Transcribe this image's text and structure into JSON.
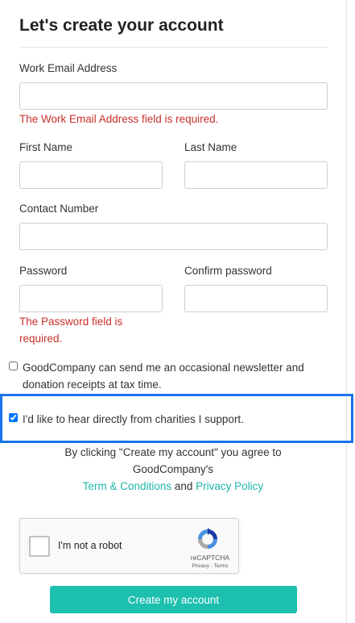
{
  "form": {
    "title": "Let's create your account",
    "email_label": "Work Email Address",
    "email_value": "",
    "email_error": "The Work Email Address field is required.",
    "first_name_label": "First Name",
    "first_name_value": "",
    "last_name_label": "Last Name",
    "last_name_value": "",
    "contact_label": "Contact Number",
    "contact_value": "",
    "password_label": "Password",
    "password_value": "",
    "password_error_line1": "The Password field is",
    "password_error_line2": "required.",
    "confirm_label": "Confirm password",
    "confirm_value": ""
  },
  "checkboxes": {
    "newsletter_line1": "GoodCompany can send me an occasional newsletter and",
    "newsletter_line2": "donation receipts at tax time.",
    "newsletter_checked": false,
    "charities": "I'd like to hear directly from charities I support.",
    "charities_checked": true
  },
  "agreement": {
    "line1": "By clicking \"Create my account\" you agree to",
    "line2": "GoodCompany's",
    "terms_link": "Term & Conditions",
    "and": "and",
    "privacy_link": "Privacy Policy"
  },
  "recaptcha": {
    "label": "I'm not a robot",
    "brand": "reCAPTCHA",
    "privacy": "Privacy",
    "separator": "-",
    "terms": "Terms"
  },
  "submit": {
    "label": "Create my account"
  },
  "colors": {
    "accent": "#1dbfaf",
    "link": "#1fb6aa",
    "error": "#c9302c",
    "highlight": "#1a73e8"
  }
}
